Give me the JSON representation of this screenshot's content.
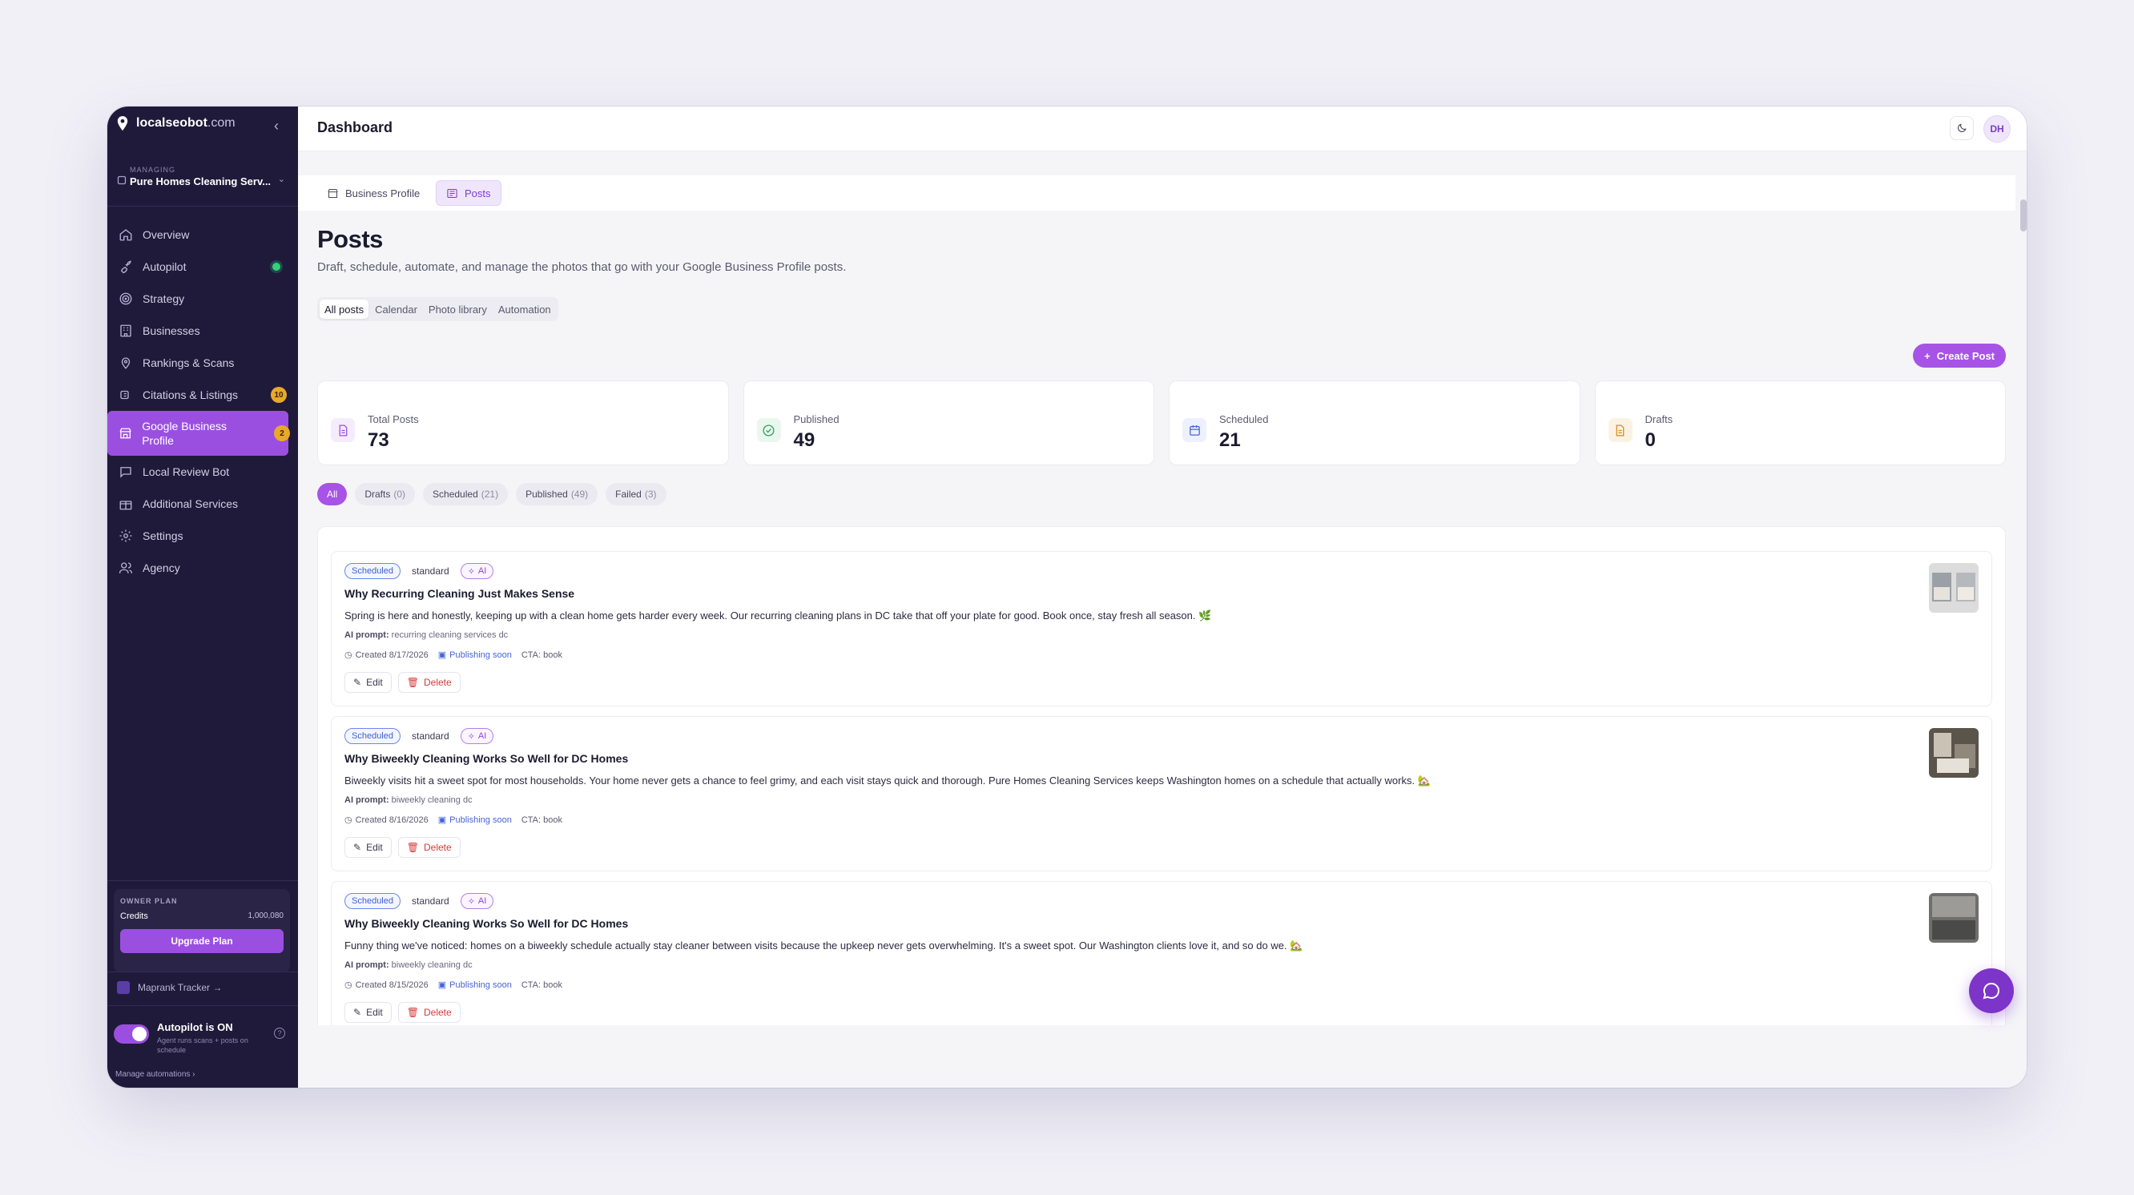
{
  "brand": {
    "name_bold": "localseobot",
    "name_dim": ".com"
  },
  "managing": {
    "label": "MANAGING",
    "business": "Pure Homes Cleaning Serv..."
  },
  "sidebar": {
    "items": [
      {
        "label": "Overview"
      },
      {
        "label": "Autopilot"
      },
      {
        "label": "Strategy"
      },
      {
        "label": "Businesses"
      },
      {
        "label": "Rankings & Scans"
      },
      {
        "label": "Citations & Listings",
        "badge": "10"
      },
      {
        "label": "Google Business Profile",
        "badge": "2"
      },
      {
        "label": "Local Review Bot"
      },
      {
        "label": "Additional Services"
      },
      {
        "label": "Settings"
      },
      {
        "label": "Agency"
      }
    ],
    "plan": {
      "heading": "OWNER PLAN",
      "credits_label": "Credits",
      "credits_value": "1,000,080",
      "upgrade": "Upgrade Plan"
    },
    "maprank": "Maprank Tracker →",
    "autopilot": {
      "title": "Autopilot is ON",
      "subtitle": "Agent runs scans + posts on schedule"
    },
    "manage": "Manage automations ›"
  },
  "topbar": {
    "title": "Dashboard",
    "avatar": "DH"
  },
  "subtabs": [
    {
      "label": "Business Profile"
    },
    {
      "label": "Posts"
    }
  ],
  "page": {
    "title": "Posts",
    "description": "Draft, schedule, automate, and manage the photos that go with your Google Business Profile posts.",
    "segtabs": [
      "All posts",
      "Calendar",
      "Photo library",
      "Automation"
    ],
    "create_button": "Create Post"
  },
  "stats": [
    {
      "label": "Total Posts",
      "value": "73",
      "color": "#9b4fe0"
    },
    {
      "label": "Published",
      "value": "49",
      "color": "#2e9e5b"
    },
    {
      "label": "Scheduled",
      "value": "21",
      "color": "#4763d8"
    },
    {
      "label": "Drafts",
      "value": "0",
      "color": "#d58a1f"
    }
  ],
  "filters": [
    {
      "label": "All",
      "count": ""
    },
    {
      "label": "Drafts",
      "count": "(0)"
    },
    {
      "label": "Scheduled",
      "count": "(21)"
    },
    {
      "label": "Published",
      "count": "(49)"
    },
    {
      "label": "Failed",
      "count": "(3)"
    }
  ],
  "posts": [
    {
      "status": "Scheduled",
      "type": "standard",
      "ai": "AI",
      "title": "Why Recurring Cleaning Just Makes Sense",
      "body": "Spring is here and honestly, keeping up with a clean home gets harder every week. Our recurring cleaning plans in DC take that off your plate for good. Book once, stay fresh all season. 🌿",
      "prompt_label": "AI prompt:",
      "prompt": "recurring cleaning services dc",
      "created": "Created 8/17/2026",
      "publishing": "Publishing soon",
      "cta": "CTA: book",
      "edit": "Edit",
      "delete": "Delete"
    },
    {
      "status": "Scheduled",
      "type": "standard",
      "ai": "AI",
      "title": "Why Biweekly Cleaning Works So Well for DC Homes",
      "body": "Biweekly visits hit a sweet spot for most households. Your home never gets a chance to feel grimy, and each visit stays quick and thorough. Pure Homes Cleaning Services keeps Washington homes on a schedule that actually works. 🏡",
      "prompt_label": "AI prompt:",
      "prompt": "biweekly cleaning dc",
      "created": "Created 8/16/2026",
      "publishing": "Publishing soon",
      "cta": "CTA: book",
      "edit": "Edit",
      "delete": "Delete"
    },
    {
      "status": "Scheduled",
      "type": "standard",
      "ai": "AI",
      "title": "Why Biweekly Cleaning Works So Well for DC Homes",
      "body": "Funny thing we've noticed: homes on a biweekly schedule actually stay cleaner between visits because the upkeep never gets overwhelming. It's a sweet spot. Our Washington clients love it, and so do we. 🏡",
      "prompt_label": "AI prompt:",
      "prompt": "biweekly cleaning dc",
      "created": "Created 8/15/2026",
      "publishing": "Publishing soon",
      "cta": "CTA: book",
      "edit": "Edit",
      "delete": "Delete"
    }
  ]
}
